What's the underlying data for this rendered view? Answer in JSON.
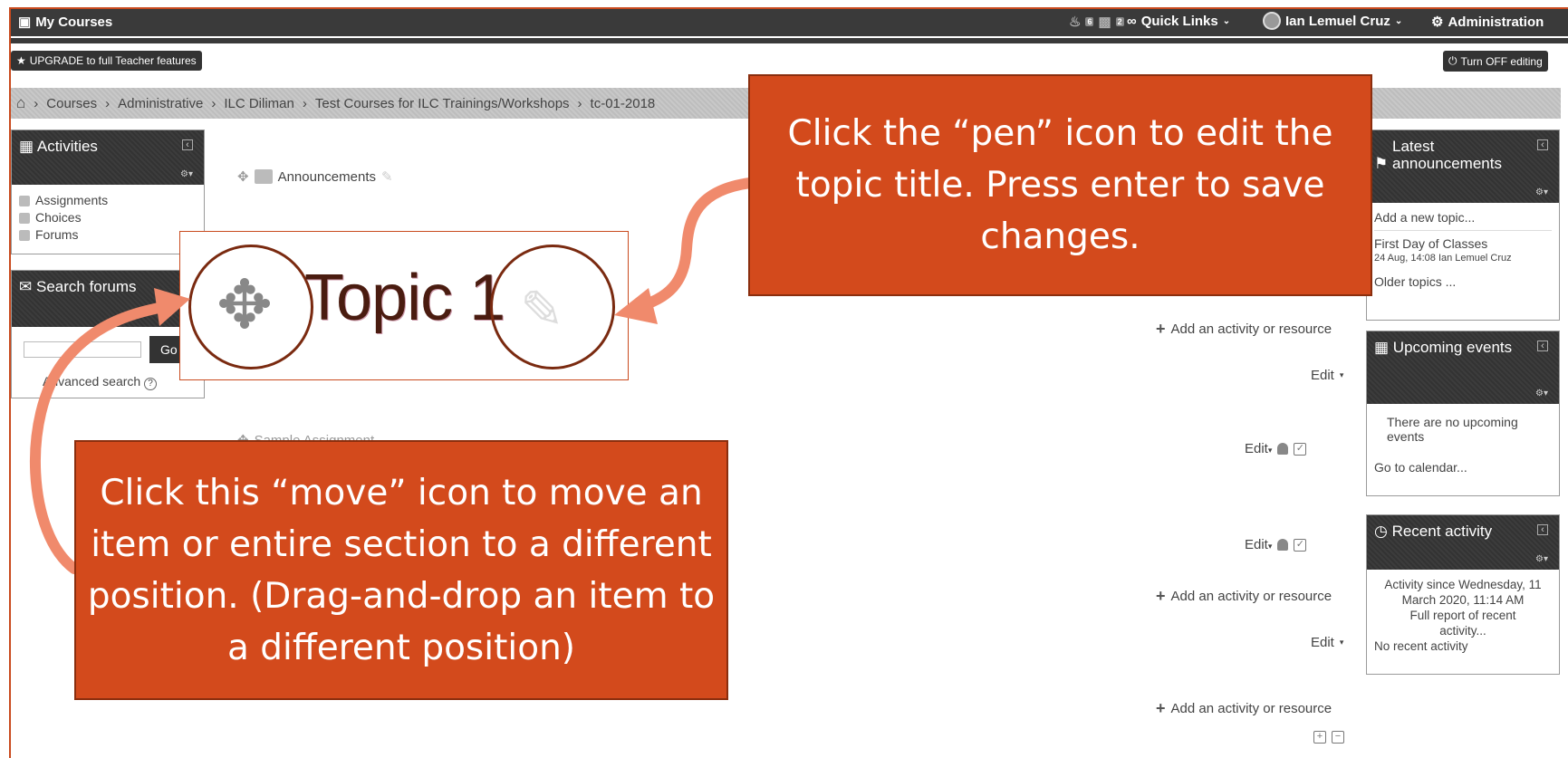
{
  "navbar": {
    "my_courses": "My Courses",
    "notif_count": "6",
    "msg_count": "2",
    "quick_links": "Quick Links",
    "user_name": "Ian Lemuel Cruz",
    "administration": "Administration"
  },
  "upgrade_button": "UPGRADE to full Teacher features",
  "editing_button": "Turn OFF editing",
  "breadcrumb": [
    "Courses",
    "Administrative",
    "ILC Diliman",
    "Test Courses for ILC Trainings/Workshops",
    "tc-01-2018"
  ],
  "activities_block": {
    "title": "Activities",
    "items": [
      "Assignments",
      "Choices",
      "Forums"
    ]
  },
  "search_block": {
    "title": "Search forums",
    "go_label": "Go",
    "advanced": "Advanced search"
  },
  "course": {
    "announcements": "Announcements",
    "topic_title": "Topic 1",
    "add_activity": "Add an activity or resource",
    "edit": "Edit",
    "sample_assignment": "Sample Assignment"
  },
  "latest_block": {
    "title": "Latest announcements",
    "add_topic": "Add a new topic...",
    "post_title": "First Day of Classes",
    "post_meta": "24 Aug, 14:08  Ian Lemuel Cruz",
    "older": "Older topics ..."
  },
  "upcoming_block": {
    "title": "Upcoming events",
    "none": "There are no upcoming events",
    "calendar": "Go to calendar..."
  },
  "recent_block": {
    "title": "Recent activity",
    "since": "Activity since Wednesday, 11 March 2020, 11:14 AM",
    "full_report": "Full report of recent activity...",
    "none": "No recent activity"
  },
  "callouts": {
    "pen": "Click the “pen” icon to edit the topic title. Press enter to save changes.",
    "move": "Click this “move” icon to move an item or entire section to a different position. (Drag-and-drop an item to a different position)"
  },
  "colors": {
    "callout": "#d34a1c",
    "arrow": "#f08a6c",
    "navbar": "#3a3a3a"
  }
}
